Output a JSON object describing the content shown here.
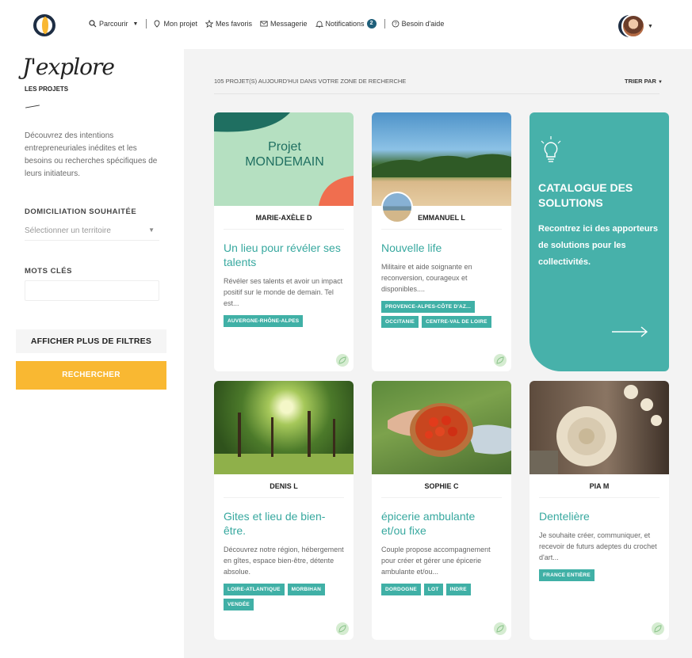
{
  "nav": {
    "items": [
      {
        "label": "Parcourir",
        "icon": "search-icon"
      },
      {
        "label": "Mon projet",
        "icon": "pin-icon"
      },
      {
        "label": "Mes favoris",
        "icon": "star-icon"
      },
      {
        "label": "Messagerie",
        "icon": "mail-icon"
      },
      {
        "label": "Notifications",
        "icon": "bell-icon"
      },
      {
        "label": "Besoin d'aide",
        "icon": "help-icon"
      }
    ],
    "notification_count": "2"
  },
  "sidebar": {
    "brand": "J'explore",
    "brand_sub": "LES PROJETS",
    "intro": "Découvrez des intentions entrepreneuriales inédites et les besoins ou recherches spécifiques de leurs initiateurs.",
    "location_label": "DOMICILIATION SOUHAITÉE",
    "location_placeholder": "Sélectionner un territoire",
    "keywords_label": "MOTS CLÉS",
    "more_filters": "AFFICHER PLUS DE FILTRES",
    "search_button": "RECHERCHER"
  },
  "results": {
    "count_text": "105 PROJET(S) AUJOURD'HUI DANS VOTRE ZONE DE RECHERCHE",
    "sort_label": "TRIER PAR"
  },
  "cards": [
    {
      "author": "MARIE-AXÈLE D",
      "image": "projet-mondemain-image",
      "image_title": "Projet MONDEMAIN",
      "title": "Un lieu pour révéler ses talents",
      "desc": "Révéler ses talents et avoir un impact positif sur le monde de demain. Tel est...",
      "tags": [
        "AUVERGNE-RHÔNE-ALPES"
      ]
    },
    {
      "author": "EMMANUEL L",
      "image": "beach-palm-trees-image",
      "title": "Nouvelle life",
      "desc": "Militaire et aide soignante en reconversion, courageux et disponibles....",
      "tags": [
        "PROVENCE-ALPES-CÔTE D'AZ...",
        "OCCITANIE",
        "CENTRE-VAL DE LOIRE"
      ]
    },
    {
      "author": "DENIS L",
      "image": "forest-sunlight-image",
      "title": "Gites et lieu de bien-être.",
      "desc": "Découvrez notre région, hébergement en gîtes, espace bien-être, détente absolue.",
      "tags": [
        "LOIRE-ATLANTIQUE",
        "MORBIHAN",
        "VENDÉE"
      ]
    },
    {
      "author": "SOPHIE C",
      "image": "tomatoes-bowl-image",
      "title": "épicerie ambulante et/ou fixe",
      "desc": "Couple propose accompagnement pour créer et gérer une épicerie ambulante et/ou...",
      "tags": [
        "DORDOGNE",
        "LOT",
        "INDRE"
      ]
    },
    {
      "author": "PIA M",
      "image": "crochet-lace-image",
      "title": "Dentelière",
      "desc": "Je souhaite créer, communiquer, et recevoir de futurs adeptes du crochet d'art...",
      "tags": [
        "FRANCE ENTIÈRE"
      ]
    }
  ],
  "catalog": {
    "title": "CATALOGUE DES SOLUTIONS",
    "text": "Recontrez ici des apporteurs de solutions pour les collectivités."
  },
  "colors": {
    "teal": "#40b0a6",
    "yellow": "#f9b832",
    "navy": "#1e2e44"
  }
}
